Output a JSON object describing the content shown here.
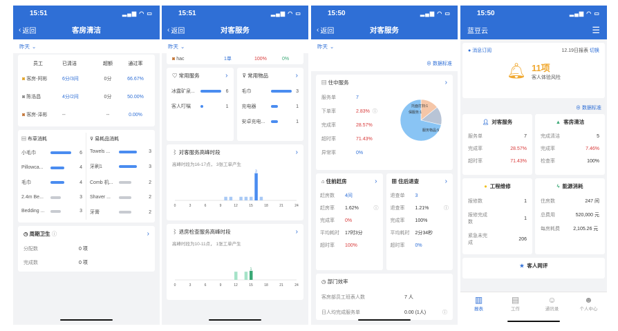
{
  "colors": {
    "brand": "#2f6fd6",
    "red": "#d83a3a",
    "green": "#3aa876",
    "bar": "#4a8cf0"
  },
  "screen1": {
    "time": "15:51",
    "back": "返回",
    "title": "客房清洁",
    "filter": "昨天",
    "table": {
      "headers": [
        "员工",
        "已清洁",
        "超额",
        "通过率"
      ],
      "rows": [
        {
          "name": "客房-阿彬",
          "cleaned": "6分/3间",
          "over": "0分",
          "rate": "66.67%"
        },
        {
          "name": "陈浩昌",
          "cleaned": "4分/2间",
          "over": "0分",
          "rate": "50.00%"
        },
        {
          "name": "客房-泽彬",
          "cleaned": "--",
          "over": "--",
          "rate": "0.00%"
        }
      ]
    },
    "linen": {
      "title": "布草消耗",
      "items": [
        {
          "label": "小毛巾",
          "value": "6"
        },
        {
          "label": "Pillowca...",
          "value": "4"
        },
        {
          "label": "毛巾",
          "value": "4"
        },
        {
          "label": "2.4m Be...",
          "value": "3"
        },
        {
          "label": "Bedding ...",
          "value": "3"
        }
      ]
    },
    "consumables": {
      "title": "易耗品消耗",
      "items": [
        {
          "label": "Towels ...",
          "value": "3"
        },
        {
          "label": "牙刷1",
          "value": "3"
        },
        {
          "label": "Comb 机...",
          "value": "2"
        },
        {
          "label": "Shaver ...",
          "value": "2"
        },
        {
          "label": "牙膏",
          "value": "2"
        }
      ]
    },
    "periodic": {
      "title": "周期卫生",
      "rows": [
        {
          "k": "分配数",
          "v": "0 项"
        },
        {
          "k": "完成数",
          "v": "0 项"
        }
      ]
    }
  },
  "screen2": {
    "time": "15:51",
    "back": "返回",
    "title": "对客服务",
    "filter": "昨天",
    "hac": {
      "name": "hac",
      "count": "1单",
      "pct": "100%",
      "zero": "0%"
    },
    "common_services": {
      "title": "常用服务",
      "items": [
        {
          "label": "冰露矿泉...",
          "value": "6"
        },
        {
          "label": "客人叮嘱",
          "value": "1"
        }
      ]
    },
    "common_goods": {
      "title": "常用物品",
      "items": [
        {
          "label": "毛巾",
          "value": "3"
        },
        {
          "label": "充电器",
          "value": "1"
        },
        {
          "label": "安卓充电...",
          "value": "1"
        }
      ]
    },
    "peak1": {
      "title": "对客服务高峰时段",
      "desc": "高峰时段为16-17点，  3张工单产生",
      "peak_label": "3"
    },
    "peak2": {
      "title": "退房检查服务高峰时段",
      "desc": "高峰时段为10-11点，  1张工单产生",
      "peak_label": "1"
    },
    "x_ticks": [
      "0",
      "3",
      "6",
      "9",
      "12",
      "15",
      "18",
      "21",
      "24"
    ]
  },
  "screen3": {
    "time": "15:50",
    "back": "返回",
    "title": "对客服务",
    "filter": "昨天",
    "data_std": "数据标准",
    "inhouse": {
      "title": "住中服务",
      "rows": [
        {
          "k": "服务单",
          "v": "7"
        },
        {
          "k": "下单率",
          "v": "2.83%"
        },
        {
          "k": "完成率",
          "v": "28.57%"
        },
        {
          "k": "超时率",
          "v": "71.43%"
        },
        {
          "k": "异常率",
          "v": "0%"
        }
      ],
      "pie_labels": [
        "托面打扫:1",
        "保服务:1",
        "服务物品:5"
      ]
    },
    "precheckin": {
      "title": "住前赶房",
      "rows": [
        {
          "k": "赶房数",
          "v": "4间"
        },
        {
          "k": "赶房率",
          "v": "1.62%"
        },
        {
          "k": "完成率",
          "v": "0%"
        },
        {
          "k": "平均耗时",
          "v": "17时3分"
        },
        {
          "k": "超时率",
          "v": "100%"
        }
      ]
    },
    "postcheckout": {
      "title": "住后退查",
      "rows": [
        {
          "k": "退查单",
          "v": "3"
        },
        {
          "k": "退查率",
          "v": "1.21%"
        },
        {
          "k": "完成率",
          "v": "100%"
        },
        {
          "k": "平均耗时",
          "v": "2分34秒"
        },
        {
          "k": "超时率",
          "v": "0%"
        }
      ]
    },
    "dept": {
      "title": "部门效率",
      "rows": [
        {
          "k": "客房部员工班表人数",
          "v": "7 人"
        },
        {
          "k": "日人均完成服务单",
          "v": "0.00 (1人)"
        }
      ]
    }
  },
  "chart_data": [
    {
      "type": "pie",
      "labels": [
        "托面打扫",
        "保服务",
        "服务物品"
      ],
      "values": [
        1,
        1,
        5
      ],
      "colors": [
        "#f5c6a8",
        "#b8c4d6",
        "#89c4f4"
      ]
    },
    {
      "type": "bar",
      "title": "对客服务高峰时段",
      "x": [
        10,
        11,
        12,
        13,
        14,
        15,
        16,
        17
      ],
      "values": [
        0.4,
        0.4,
        0,
        0.4,
        0.4,
        0.4,
        3,
        0.4
      ],
      "xlim": [
        0,
        24
      ]
    },
    {
      "type": "bar",
      "title": "退房检查服务高峰时段",
      "x": [
        12,
        13,
        14,
        15
      ],
      "values": [
        0.9,
        0,
        0.9,
        1
      ],
      "xlim": [
        0,
        24
      ]
    }
  ],
  "screen4": {
    "time": "15:50",
    "app_title": "蓝豆云",
    "msg": {
      "label": "消息订阅",
      "report": "12.19日报表",
      "switch": "切换",
      "count": "11项",
      "desc": "客人体验风险"
    },
    "data_std": "数据标准",
    "guest_service": {
      "title": "对客服务",
      "rows": [
        {
          "k": "服务单",
          "v": "7"
        },
        {
          "k": "完成率",
          "v": "28.57%"
        },
        {
          "k": "超时率",
          "v": "71.43%"
        }
      ]
    },
    "room_clean": {
      "title": "客房清洁",
      "rows": [
        {
          "k": "完成清洁",
          "v": "5"
        },
        {
          "k": "完成率",
          "v": "7.46%"
        },
        {
          "k": "检查率",
          "v": "100%"
        }
      ]
    },
    "maintenance": {
      "title": "工程维修",
      "rows": [
        {
          "k": "报修数",
          "v": "1"
        },
        {
          "k": "报修完成数",
          "v": "1"
        },
        {
          "k": "紧急未完成",
          "v": "206"
        }
      ]
    },
    "energy": {
      "title": "能源消耗",
      "rows": [
        {
          "k": "住房数",
          "v": "247 间"
        },
        {
          "k": "总费用",
          "v": "520,000 元"
        },
        {
          "k": "每房耗费",
          "v": "2,105.26 元"
        }
      ]
    },
    "review": {
      "title": "客人网评"
    },
    "tabs": [
      {
        "label": "报表"
      },
      {
        "label": "工作"
      },
      {
        "label": "通讯录"
      },
      {
        "label": "个人中心"
      }
    ]
  }
}
